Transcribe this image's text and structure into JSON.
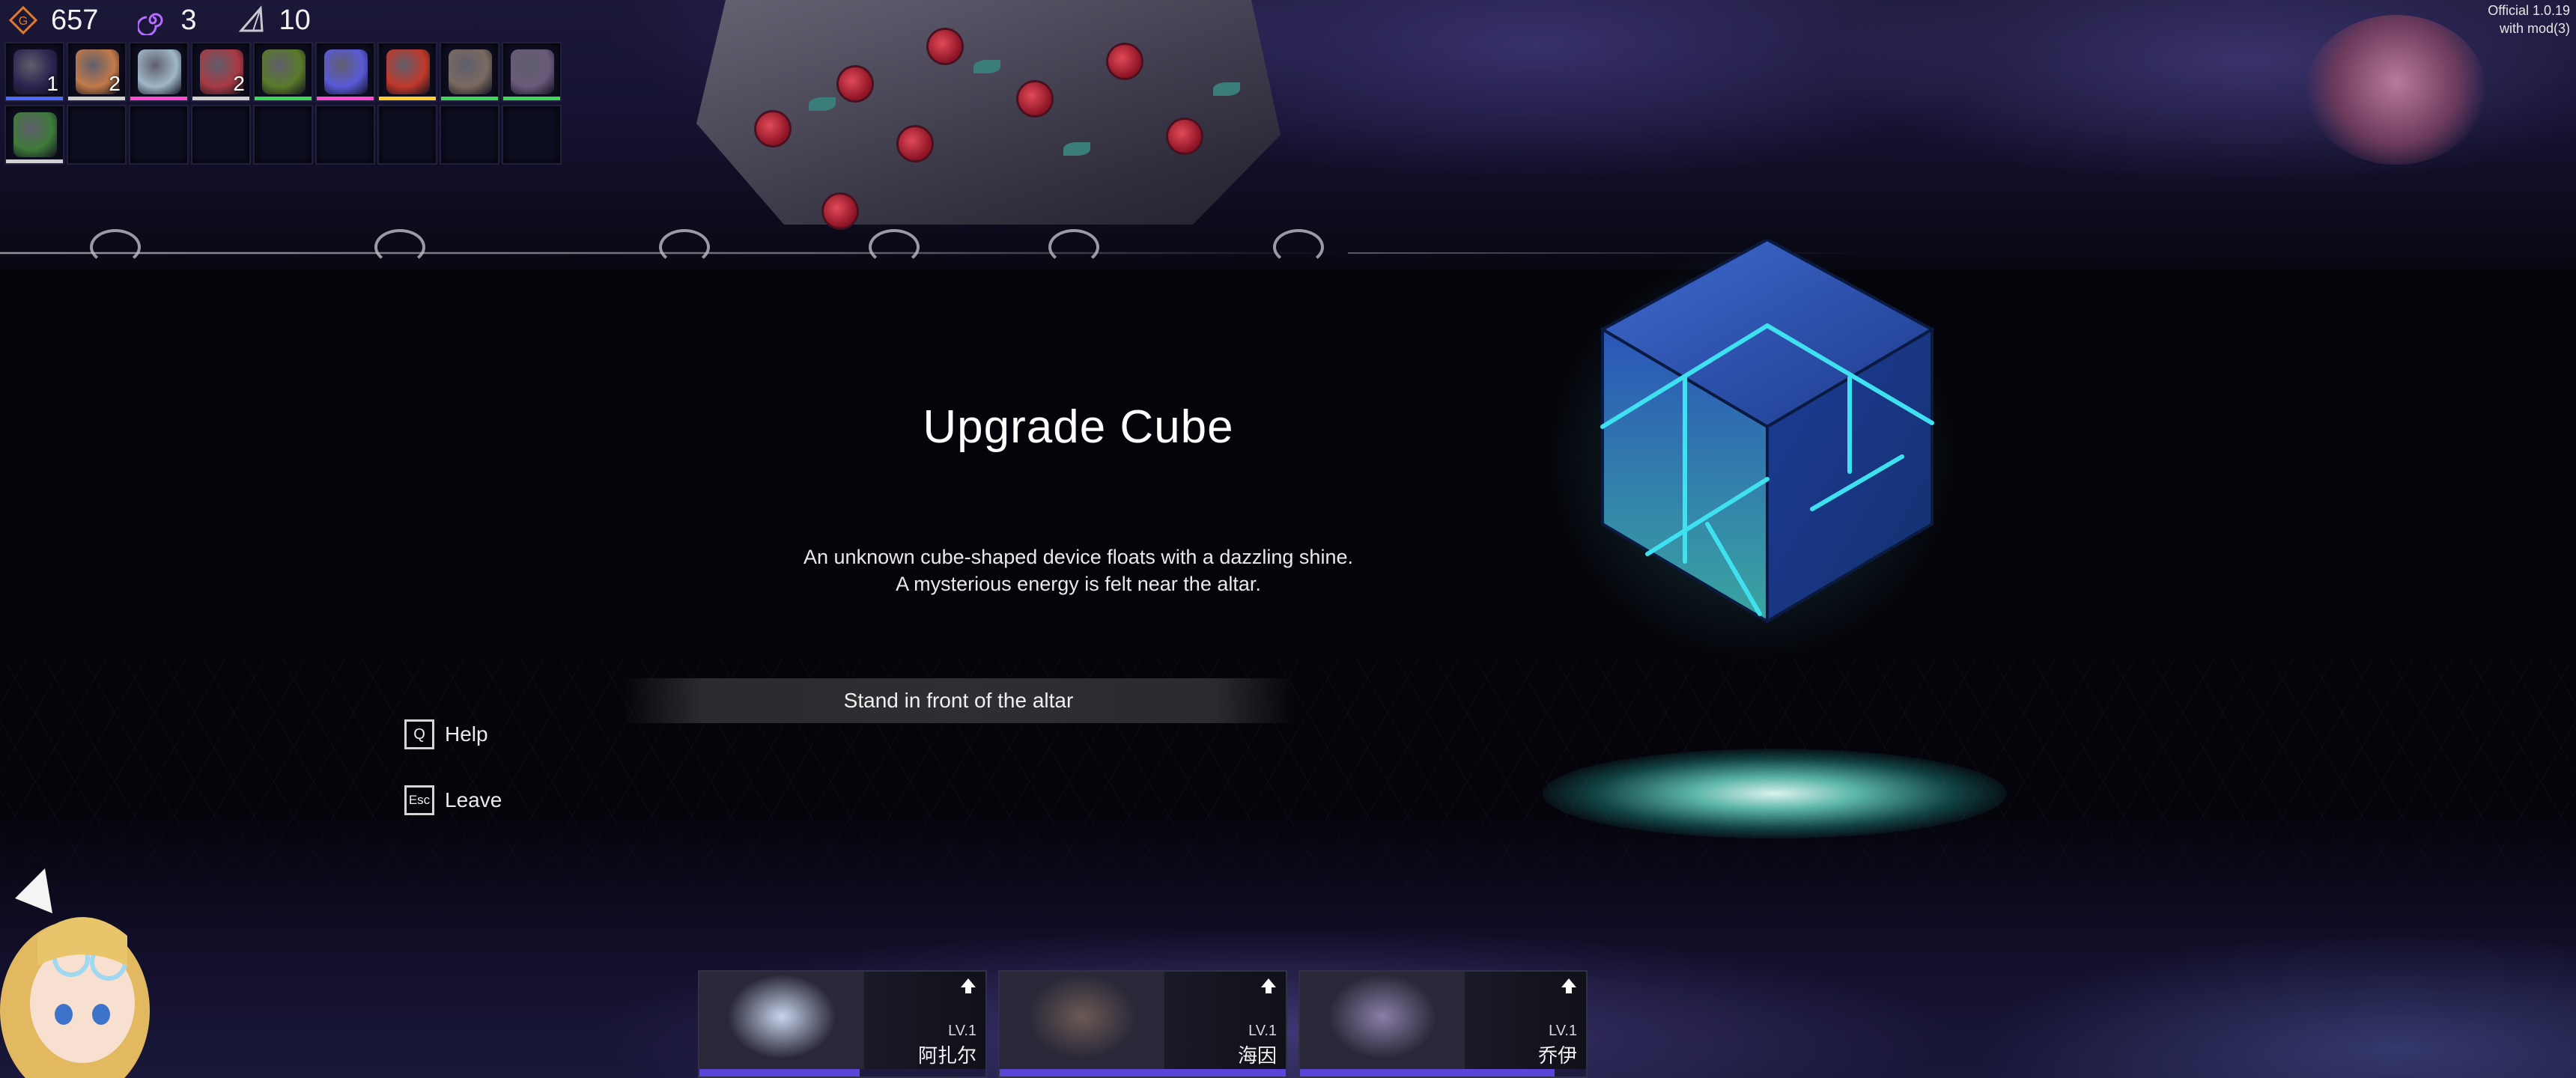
{
  "resources": [
    {
      "icon": "gold-coin-icon",
      "value": "657",
      "color": "#e07b2a"
    },
    {
      "icon": "purple-spiral-icon",
      "value": "3",
      "color": "#b46cff"
    },
    {
      "icon": "triangle-shard-icon",
      "value": "10",
      "color": "#c8c8d0"
    }
  ],
  "inventory": {
    "row1": [
      {
        "icon": "dark-orb-item-icon",
        "count": "1",
        "rarity": "#4b6cff",
        "art": "#2a2550"
      },
      {
        "icon": "bread-item-icon",
        "count": "2",
        "rarity": "#d0d0d0",
        "art": "#c27a4a"
      },
      {
        "icon": "ice-cube-item-icon",
        "count": "",
        "rarity": "#ff4bd2",
        "art": "#9fb7c8"
      },
      {
        "icon": "pill-capsule-item-icon",
        "count": "2",
        "rarity": "#d0d0d0",
        "art": "#a83a44"
      },
      {
        "icon": "green-orb-item-icon",
        "count": "",
        "rarity": "#3fd45a",
        "art": "#5a7a2a"
      },
      {
        "icon": "clover-box-item-icon",
        "count": "",
        "rarity": "#ff4bd2",
        "art": "#5a5ad8"
      },
      {
        "icon": "red-book-item-icon",
        "count": "",
        "rarity": "#ffcc33",
        "art": "#c0392b"
      },
      {
        "icon": "unknown-item-icon",
        "count": "",
        "rarity": "#3fd45a",
        "art": "#7a6a60"
      },
      {
        "icon": "unknown-item-icon",
        "count": "",
        "rarity": "#3fd45a",
        "art": "#6a5a7a"
      }
    ],
    "row2": [
      {
        "icon": "green-herb-item-icon",
        "count": "",
        "rarity": "#d0d0d0",
        "art": "#3f7a3a"
      }
    ],
    "empty_slots_row2": 8
  },
  "version": {
    "line1": "Official 1.0.19",
    "line2": "with mod(3)"
  },
  "event": {
    "title": "Upgrade Cube",
    "description_line1": "An unknown cube-shaped device floats with a dazzling shine.",
    "description_line2": "A mysterious energy is felt near the altar.",
    "choice": "Stand in front of the altar"
  },
  "hotkeys": [
    {
      "key": "Q",
      "label": "Help"
    },
    {
      "key": "Esc",
      "label": "Leave"
    }
  ],
  "party": [
    {
      "name": "阿扎尔",
      "level": "LV.1",
      "hp_fraction": 0.56,
      "face_color": "#c9d6ee"
    },
    {
      "name": "海因",
      "level": "LV.1",
      "hp_fraction": 1.0,
      "face_color": "#6b5a55"
    },
    {
      "name": "乔伊",
      "level": "LV.1",
      "hp_fraction": 0.89,
      "face_color": "#8a7fa8"
    }
  ],
  "colors": {
    "accent_cyan": "#3fe0f0",
    "hp_bar": "#5a45d8",
    "background": "#04040a"
  }
}
